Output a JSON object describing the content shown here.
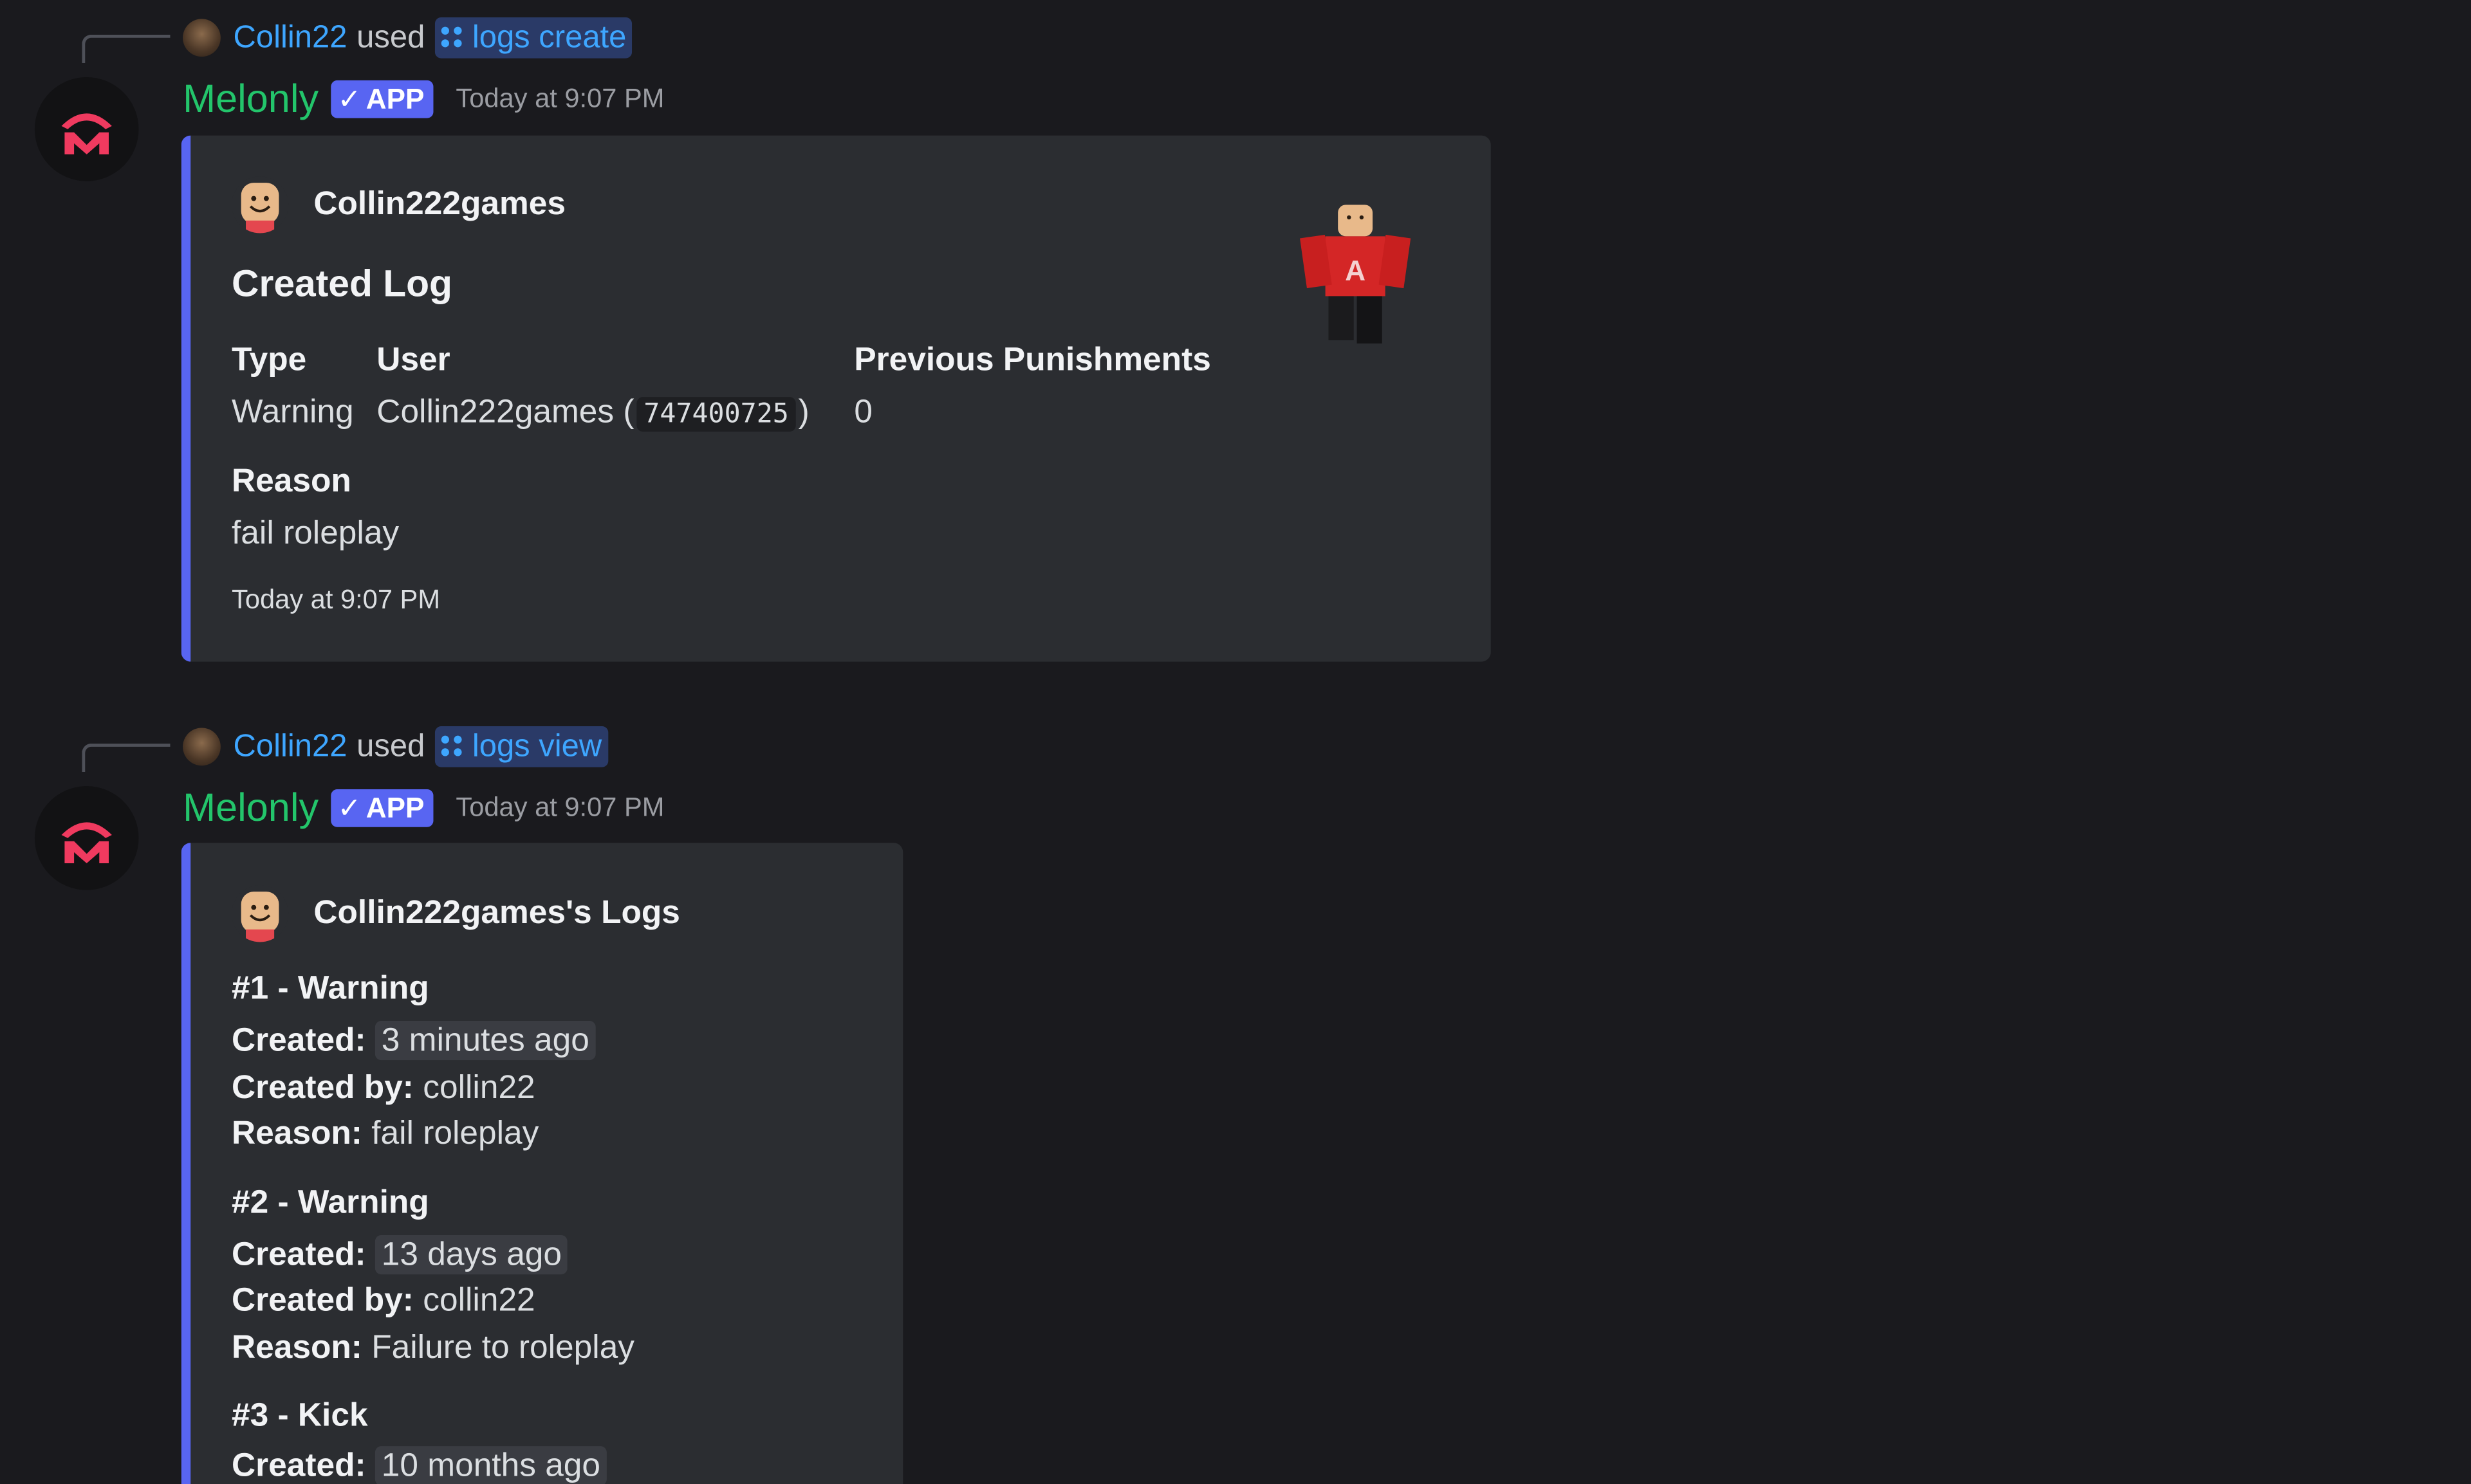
{
  "messages": [
    {
      "reply": {
        "user": "Collin22",
        "used_text": "used",
        "command": "logs create"
      },
      "bot": {
        "name": "Melonly",
        "badge": "APP",
        "timestamp": "Today at 9:07 PM"
      },
      "embed": {
        "author": "Collin222games",
        "title": "Created Log",
        "fields": {
          "type": {
            "name": "Type",
            "value": "Warning"
          },
          "user": {
            "name": "User",
            "value_prefix": "Collin222games",
            "value_id": "747400725"
          },
          "previous": {
            "name": "Previous Punishments",
            "value": "0"
          },
          "reason": {
            "name": "Reason",
            "value": "fail roleplay"
          }
        },
        "footer": "Today at 9:07 PM"
      }
    },
    {
      "reply": {
        "user": "Collin22",
        "used_text": "used",
        "command": "logs view"
      },
      "bot": {
        "name": "Melonly",
        "badge": "APP",
        "timestamp": "Today at 9:07 PM"
      },
      "embed": {
        "author": "Collin222games's Logs",
        "logs": [
          {
            "heading": "#1 - Warning",
            "created_label": "Created:",
            "created": "3 minutes ago",
            "created_by_label": "Created by:",
            "created_by": "collin22",
            "reason_label": "Reason:",
            "reason": "fail roleplay"
          },
          {
            "heading": "#2 - Warning",
            "created_label": "Created:",
            "created": "13 days ago",
            "created_by_label": "Created by:",
            "created_by": "collin22",
            "reason_label": "Reason:",
            "reason": "Failure to roleplay"
          },
          {
            "heading": "#3 - Kick",
            "created_label": "Created:",
            "created": "10 months ago"
          }
        ]
      }
    }
  ],
  "colors": {
    "background": "#1a1a1e",
    "embed_bg": "#2b2d31",
    "embed_accent": "#5865f2",
    "bot_name": "#23c56b",
    "mention": "#3ea6ff",
    "app_badge": "#5865f2",
    "melonly_logo": "#f03a5f"
  },
  "icons": [
    "reply-connector",
    "user-mini-avatar",
    "slash-command-icon",
    "melonly-logo-icon",
    "checkmark-icon",
    "roblox-headshot-icon",
    "roblox-avatar-thumbnail"
  ]
}
